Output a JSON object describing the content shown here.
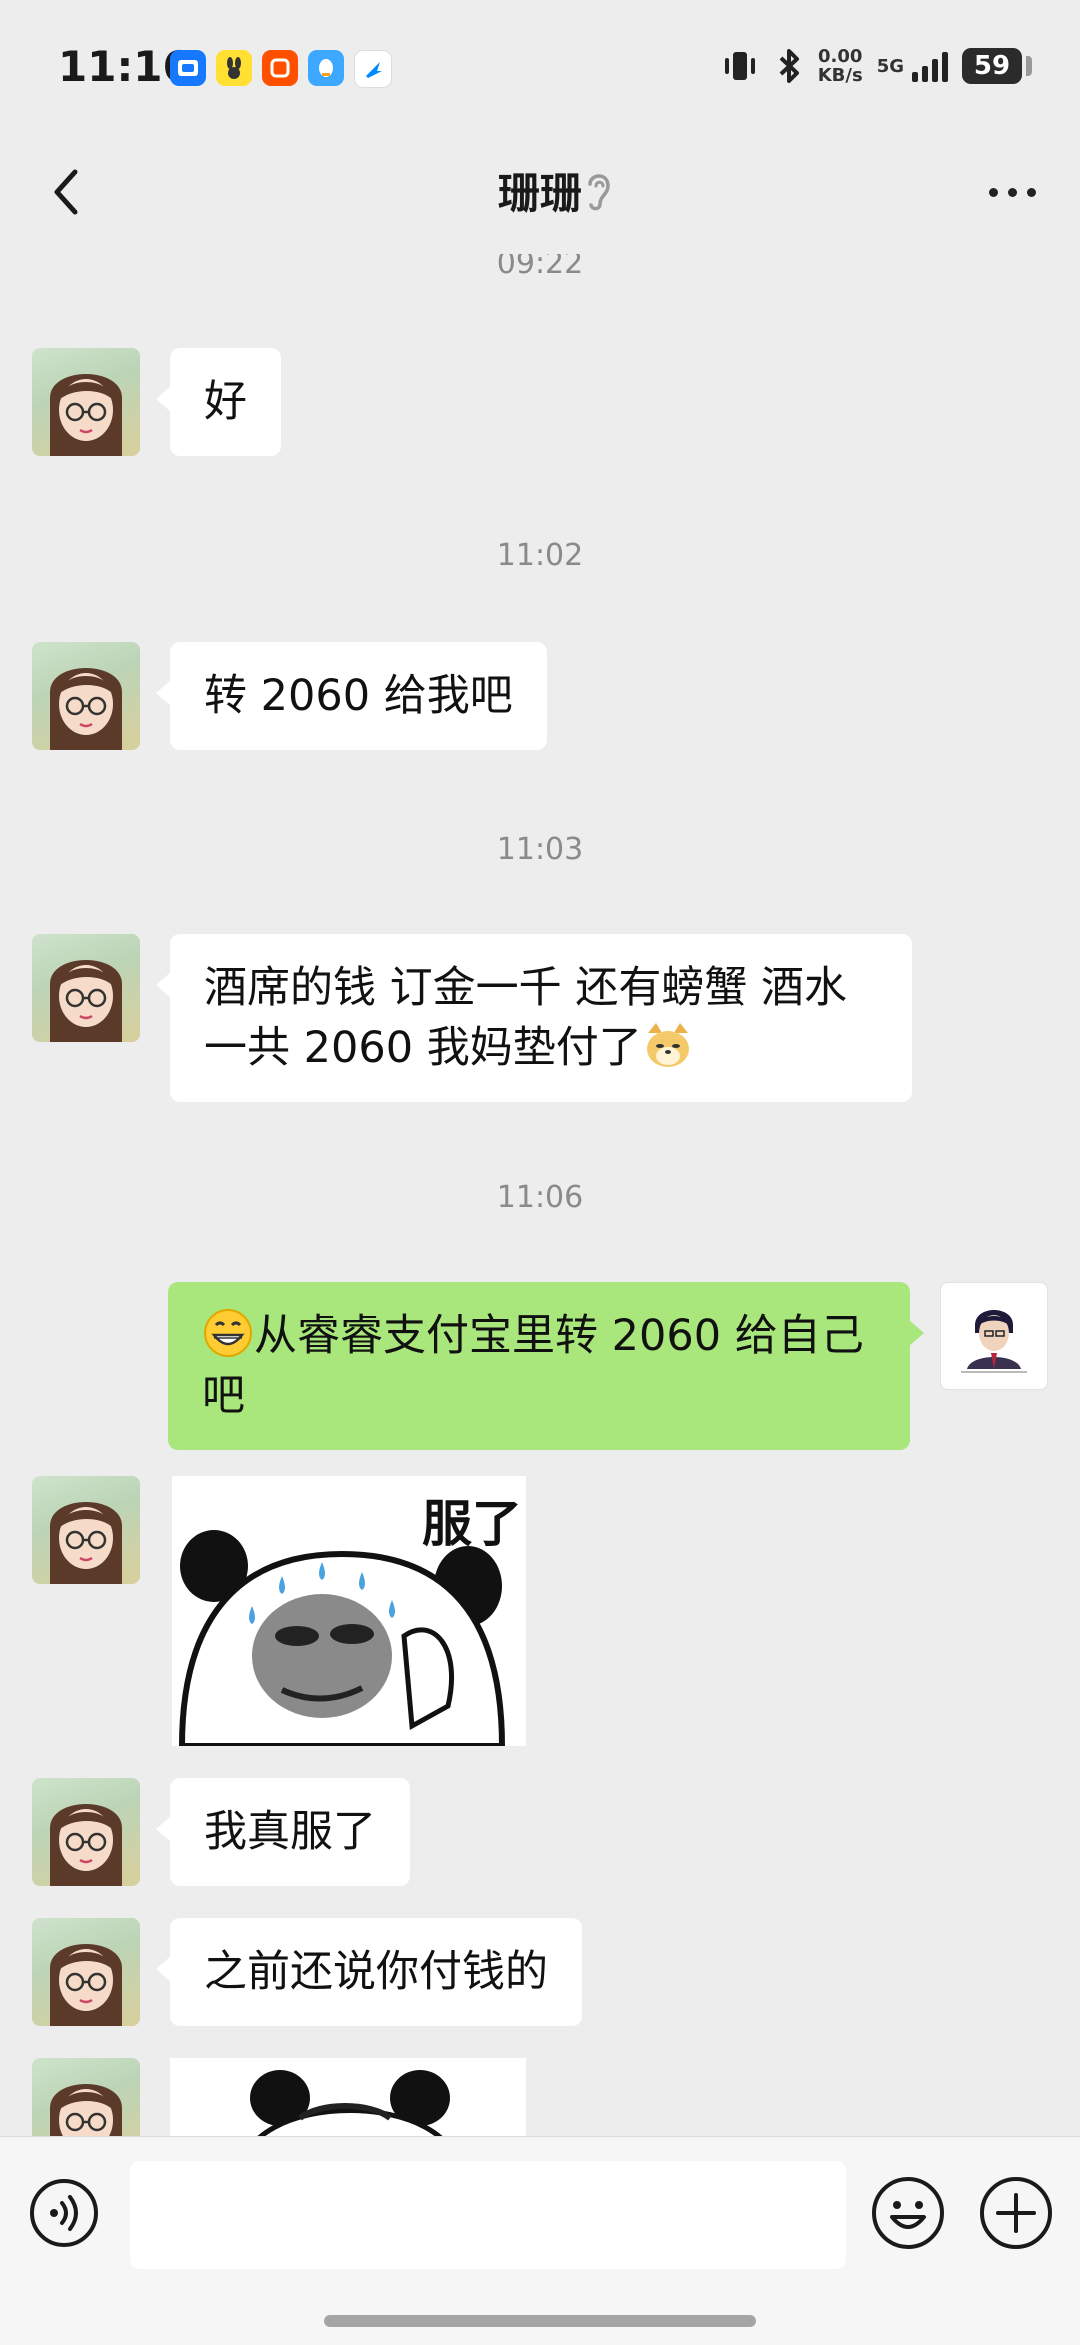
{
  "status_bar": {
    "time": "11:16",
    "net_speed_value": "0.00",
    "net_speed_unit": "KB/s",
    "network": "5G",
    "battery": "59",
    "notification_icons": [
      "alipay-icon",
      "xianyu-icon",
      "taobao-icon",
      "qq-icon",
      "dingtalk-icon"
    ]
  },
  "header": {
    "title": "珊珊",
    "icons": [
      "back-arrow-icon",
      "earpiece-icon",
      "more-options-icon"
    ]
  },
  "messages": [
    {
      "kind": "timestamp",
      "text": "09:22"
    },
    {
      "kind": "incoming",
      "text": "好"
    },
    {
      "kind": "timestamp",
      "text": "11:02"
    },
    {
      "kind": "incoming",
      "text": "转 2060 给我吧"
    },
    {
      "kind": "timestamp",
      "text": "11:03"
    },
    {
      "kind": "incoming",
      "line1": "酒席的钱 订金一千 还有螃蟹 酒水",
      "line2": "一共 2060 我妈垫付了",
      "emoji": "doge-emoji"
    },
    {
      "kind": "timestamp",
      "text": "11:06"
    },
    {
      "kind": "outgoing",
      "emoji": "grin-emoji",
      "line1": "从睿睿支付宝里转 2060 给自己",
      "line2": "吧"
    },
    {
      "kind": "incoming-sticker",
      "caption": "服了",
      "sticker": "panda-sweating-sticker"
    },
    {
      "kind": "incoming",
      "text": "我真服了"
    },
    {
      "kind": "incoming",
      "text": "之前还说你付钱的"
    },
    {
      "kind": "incoming-sticker",
      "caption": "",
      "sticker": "panda-sticker"
    }
  ],
  "input_bar": {
    "text_value": "",
    "icons": [
      "voice-input-icon",
      "emoji-icon",
      "plus-icon"
    ]
  },
  "colors": {
    "chat_background": "#ededed",
    "incoming_bubble": "#ffffff",
    "outgoing_bubble": "#a9e77c"
  }
}
